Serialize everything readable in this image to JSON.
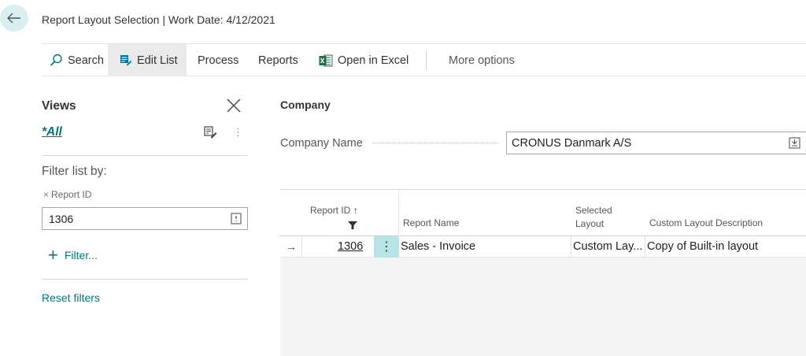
{
  "page": {
    "title": "Report Layout Selection | Work Date: 4/12/2021"
  },
  "actions": {
    "search": "Search",
    "edit_list": "Edit List",
    "process": "Process",
    "reports": "Reports",
    "open_in_excel": "Open in Excel",
    "more_options": "More options"
  },
  "views": {
    "title": "Views",
    "current": "*All",
    "filter_title": "Filter list by:",
    "filter_field": "Report ID",
    "filter_value": "1306",
    "add_filter": "Filter...",
    "reset": "Reset filters"
  },
  "company": {
    "section": "Company",
    "label": "Company Name",
    "value": "CRONUS Danmark A/S"
  },
  "grid": {
    "columns": {
      "report_id": "Report ID",
      "report_name": "Report Name",
      "selected_layout_1": "Selected",
      "selected_layout_2": "Layout",
      "custom_desc": "Custom Layout Description"
    },
    "rows": [
      {
        "report_id": "1306",
        "report_name": "Sales - Invoice",
        "selected_layout": "Custom Lay...",
        "custom_desc": "Copy of Built-in layout"
      }
    ]
  },
  "colors": {
    "accent": "#00777a",
    "back_bg": "#d8eef0",
    "excel": "#1e7145",
    "edit_list_icon": "#0078a8"
  },
  "icons": [
    "arrow-left-icon",
    "search-icon",
    "edit-list-icon",
    "excel-icon",
    "close-icon",
    "edit-view-icon",
    "ellipsis-icon",
    "filter-funnel-icon",
    "sort-up-icon",
    "lookup-icon",
    "row-arrow-icon",
    "row-menu-icon"
  ]
}
